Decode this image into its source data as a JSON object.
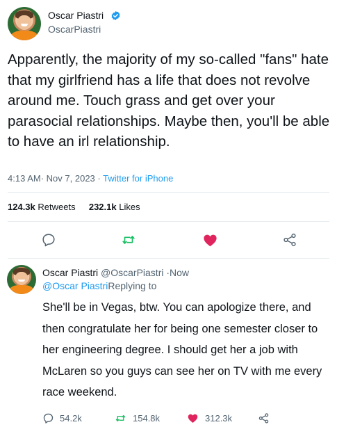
{
  "tweet": {
    "author_name": "Oscar Piastri",
    "author_handle": "OscarPiastri",
    "text": "Apparently, the majority of my so-called \"fans\" hate that my girlfriend has a life that does not revolve around me. Touch grass and get over your parasocial relationships. Maybe then, you'll be able to have an irl relationship.",
    "time": "4:13 AM",
    "date": "Nov 7, 2023",
    "separator": "·",
    "source": "Twitter for iPhone",
    "retweets_count": "124.3k",
    "retweets_label": "Retweets",
    "likes_count": "232.1k",
    "likes_label": "Likes",
    "icons": [
      "reply-icon",
      "retweet-icon",
      "heart-icon",
      "share-icon"
    ],
    "colors": {
      "retweet": "#17bf63",
      "like": "#e0245e",
      "link": "#1d9bf0"
    }
  },
  "reply": {
    "author_name": "Oscar Piastri",
    "author_handle": "@OscarPiastri",
    "time_separator": "·",
    "time": "Now",
    "replying_to_handle": "@Oscar Piastri",
    "replying_to_label": "Replying to",
    "text": "She'll be in Vegas, btw. You can apologize there, and then congratulate her for being one semester closer to her engineering degree. I should get her a job with McLaren so you guys can see her on TV with me every race weekend.",
    "reply_count": "54.2k",
    "retweet_count": "154.8k",
    "like_count": "312.3k"
  }
}
